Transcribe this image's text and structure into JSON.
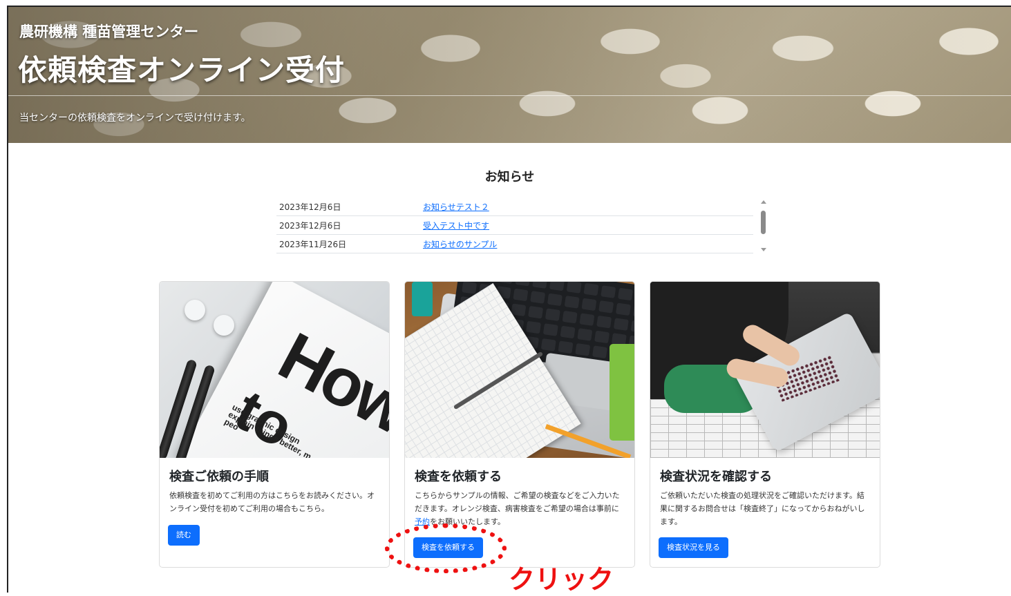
{
  "header": {
    "org": "農研機構 種苗管理センター",
    "title": "依頼検査オンライン受付",
    "subtitle": "当センターの依頼検査をオンラインで受け付けます。"
  },
  "news": {
    "heading": "お知らせ",
    "items": [
      {
        "date": "2023年12月6日",
        "title": "お知らせテスト２"
      },
      {
        "date": "2023年12月6日",
        "title": "受入テスト中です"
      },
      {
        "date": "2023年11月26日",
        "title": "お知らせのサンプル"
      }
    ]
  },
  "cards": [
    {
      "title": "検査ご依頼の手順",
      "text": "依頼検査を初めてご利用の方はこちらをお読みください。オンライン受付を初めてご利用の場合もこちら。",
      "button": "読む"
    },
    {
      "title": "検査を依頼する",
      "text_before": "こちらからサンプルの情報、ご希望の検査などをご入力いただきます。オレンジ検査、病害検査をご希望の場合は事前に",
      "link": "予約",
      "text_after": "をお願いいたします。",
      "button": "検査を依頼する"
    },
    {
      "title": "検査状況を確認する",
      "text": "ご依頼いただいた検査の処理状況をご確認いただけます。結果に関するお問合せは「検査終了」になってからおねがいします。",
      "button": "検査状況を見る"
    }
  ],
  "card_images": {
    "howto_text": "How",
    "howto_text2": "to",
    "howto_small": "use graphic design explain things better, m peo"
  },
  "annotation": {
    "label": "クリック"
  },
  "colors": {
    "primary": "#0d6efd",
    "annotation": "#ee1111"
  }
}
